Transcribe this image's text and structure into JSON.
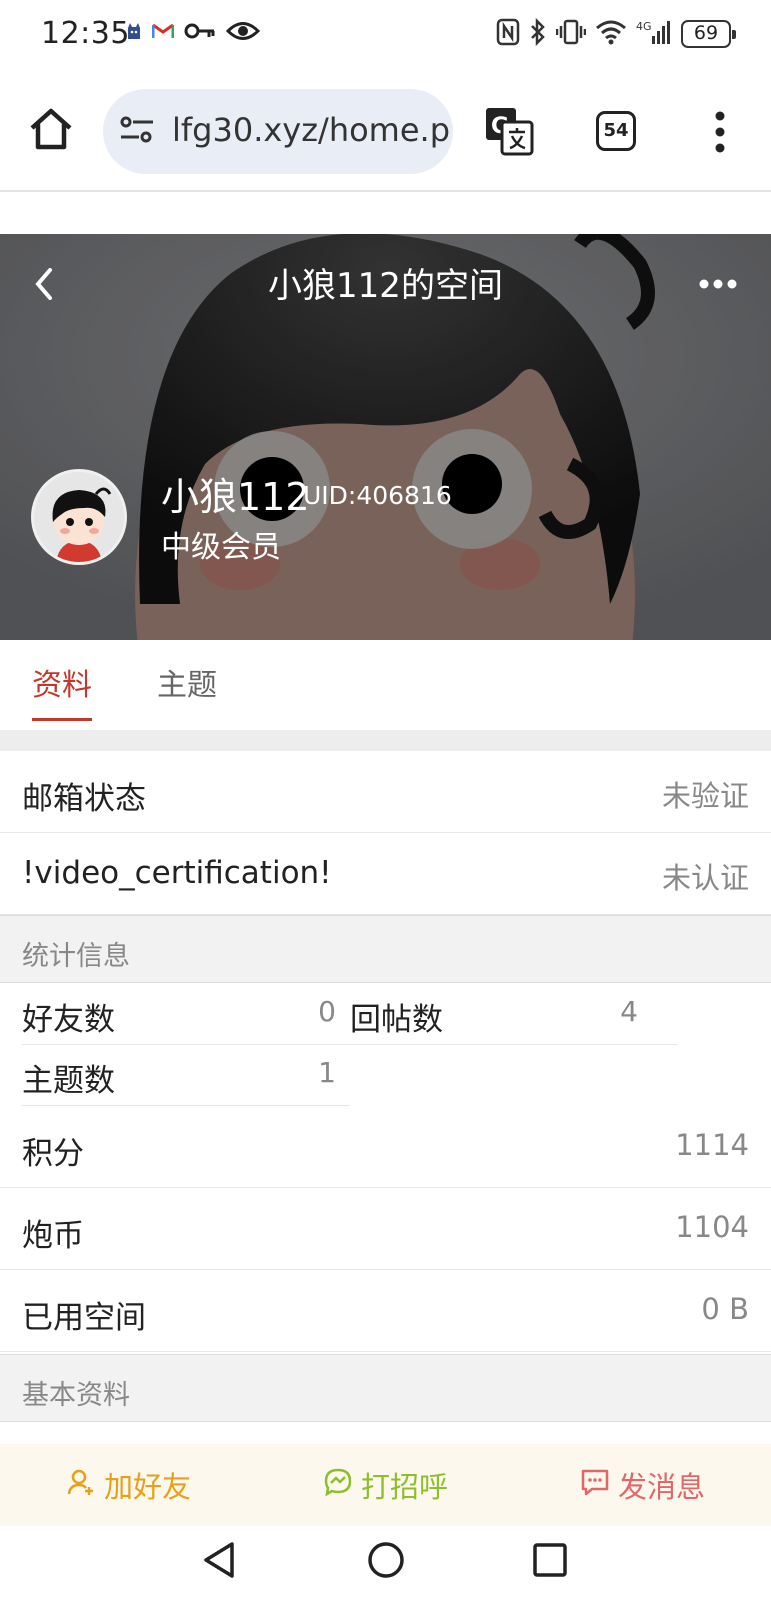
{
  "status_bar": {
    "time": "12:35",
    "battery": "69",
    "network": "4G"
  },
  "browser": {
    "url": "lfg30.xyz/home.p",
    "tab_count": "54"
  },
  "profile": {
    "page_title": "小狼112的空间",
    "username": "小狼112",
    "uid": "UID:406816",
    "member_level": "中级会员"
  },
  "tabs": [
    {
      "label": "资料",
      "active": true
    },
    {
      "label": "主题",
      "active": false
    }
  ],
  "verification": [
    {
      "label": "邮箱状态",
      "value": "未验证"
    },
    {
      "label": "!video_certification!",
      "value": "未认证"
    }
  ],
  "stats_section": {
    "title": "统计信息",
    "cells": [
      {
        "label": "好友数",
        "value": "0"
      },
      {
        "label": "回帖数",
        "value": "4"
      },
      {
        "label": "主题数",
        "value": "1"
      }
    ]
  },
  "stats_rows": [
    {
      "label": "积分",
      "value": "1114"
    },
    {
      "label": "炮币",
      "value": "1104"
    },
    {
      "label": "已用空间",
      "value": "0 B"
    }
  ],
  "basic_section": {
    "title": "基本资料"
  },
  "actions": {
    "add_friend": "加好友",
    "greet": "打招呼",
    "message": "发消息"
  },
  "colors": {
    "accent": "#c0392b",
    "add_friend": "#e6a019",
    "greet": "#8cbf2b",
    "message": "#e26767"
  }
}
